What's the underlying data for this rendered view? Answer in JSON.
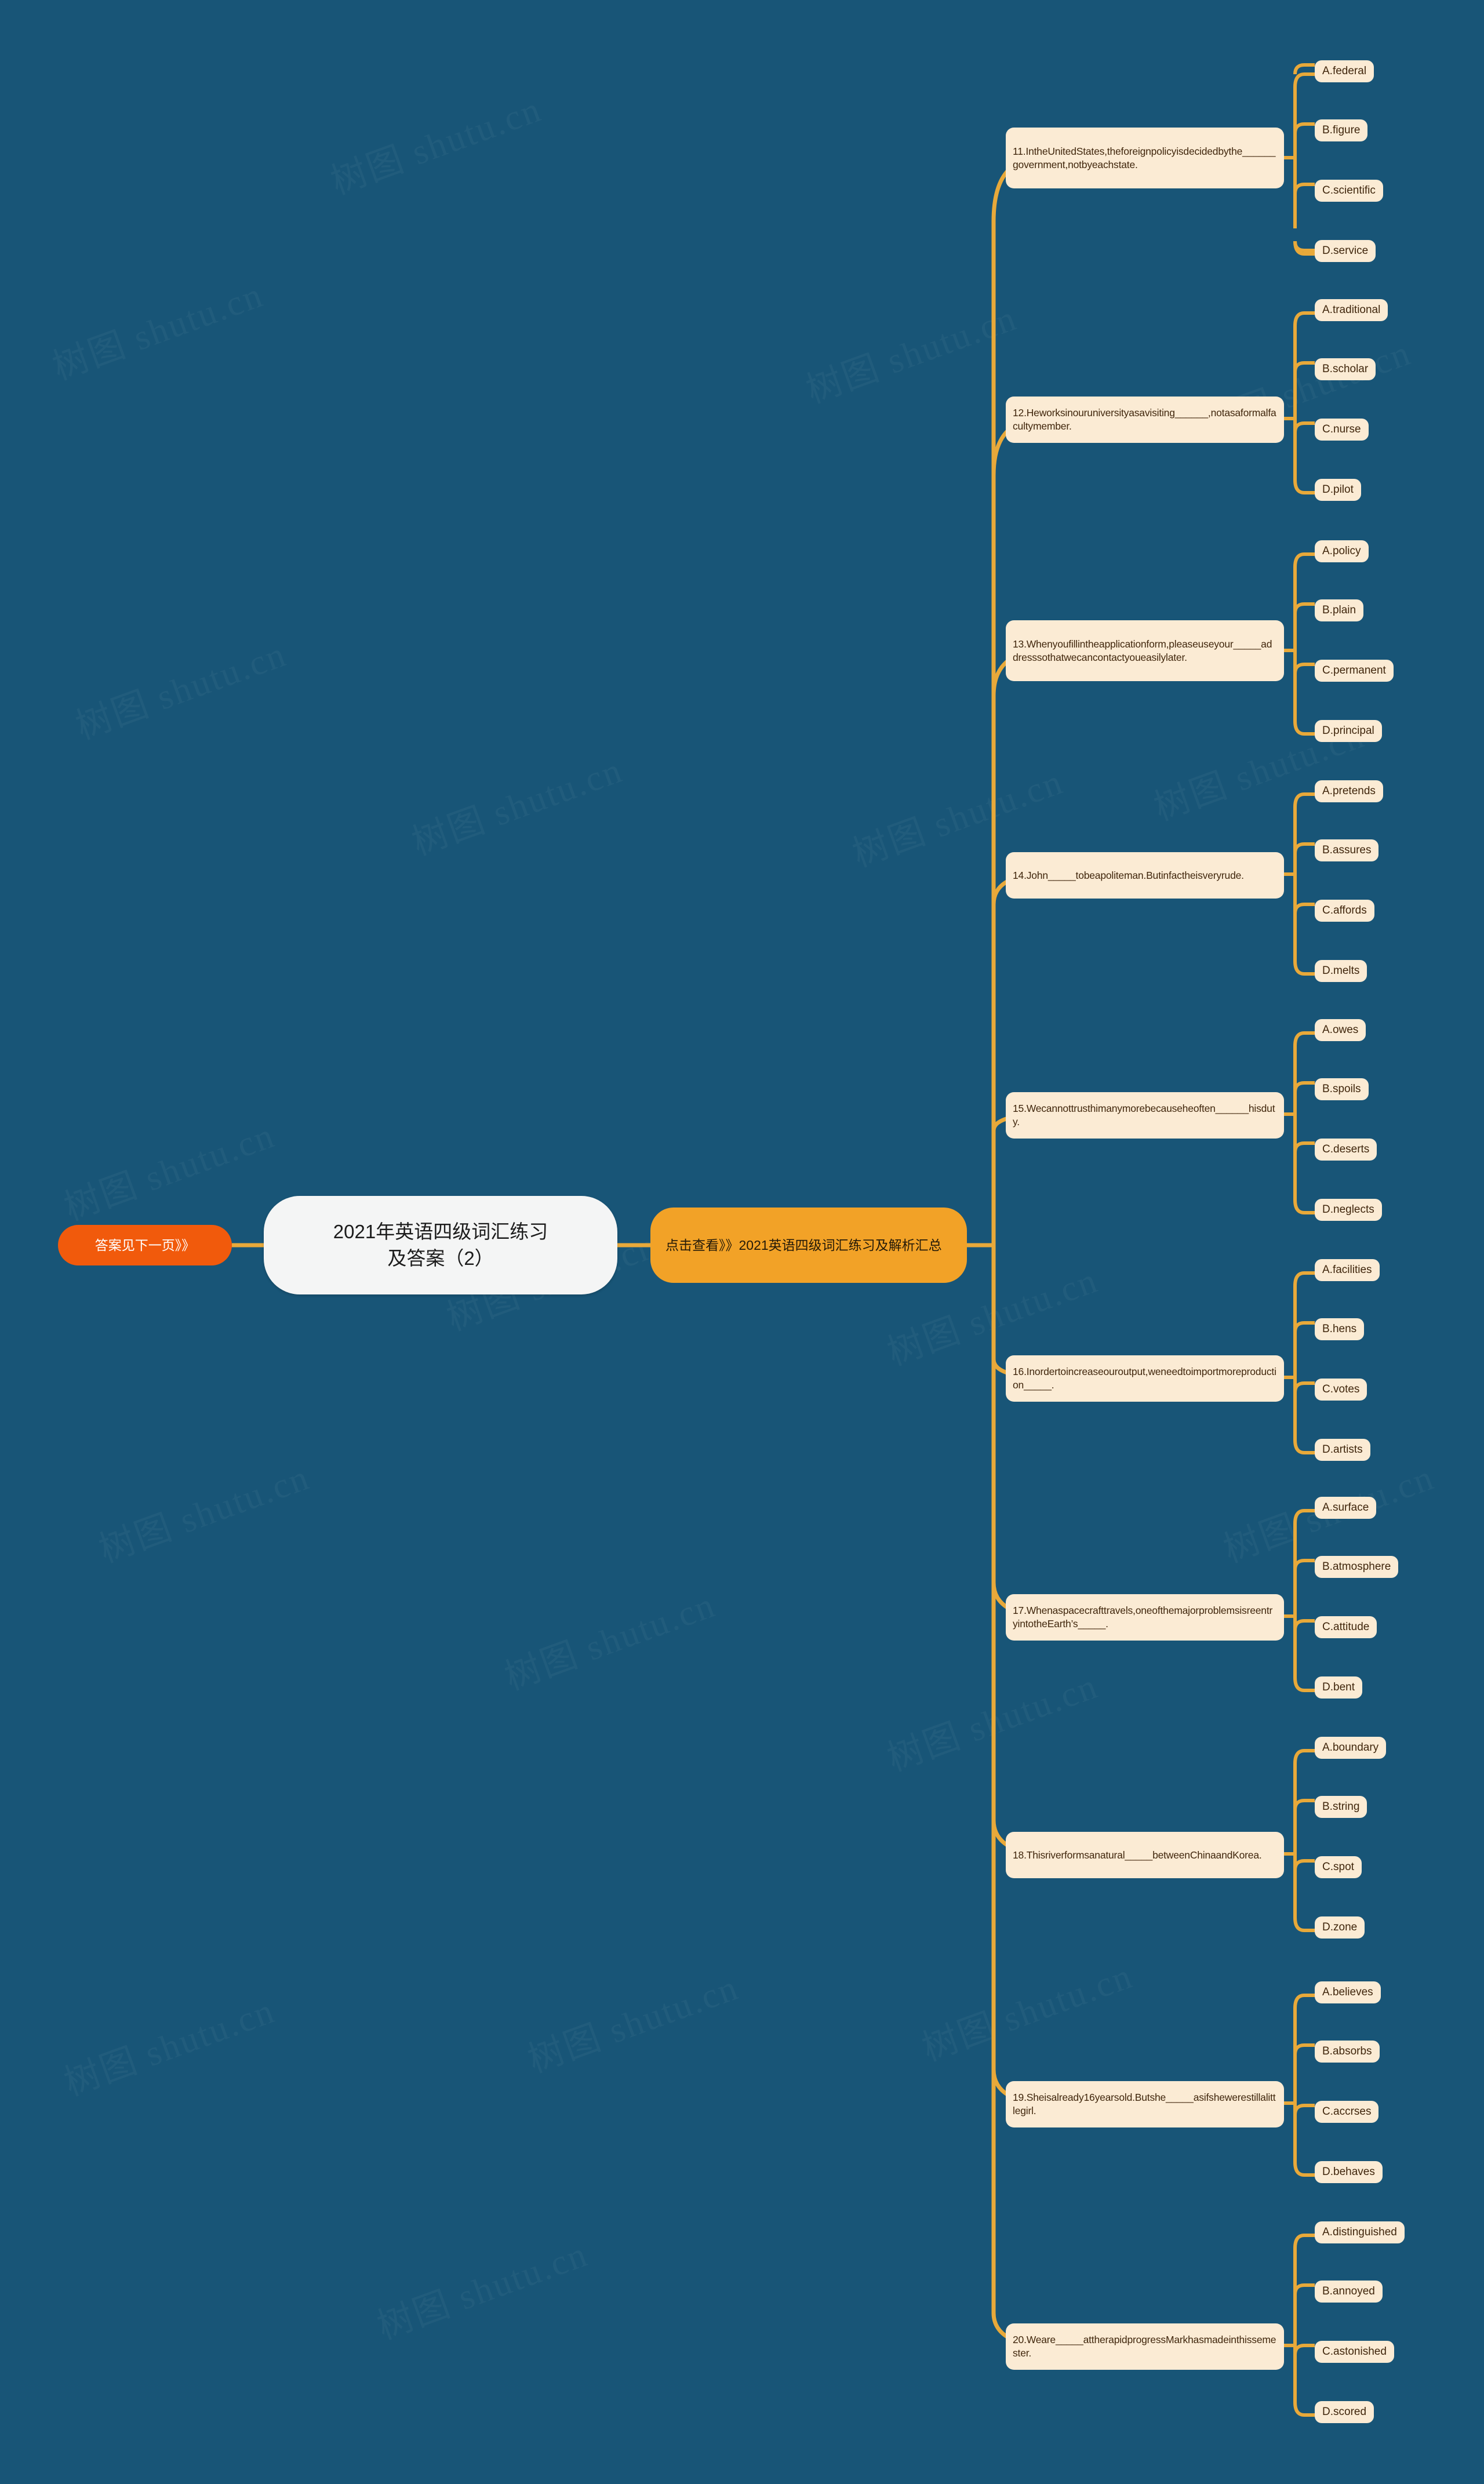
{
  "canvas": {
    "background_color": "#185577",
    "connector_color": "#E8A93A",
    "watermark_text": "树图 shutu.cn"
  },
  "root": {
    "label": "2021年英语四级词汇练习及答案（2）",
    "line1": "2021年英语四级词汇练习",
    "line2": "及答案（2）",
    "background_color": "#F4F5F5",
    "text_color": "#1C1C1C"
  },
  "left_branch": {
    "label": "答案见下一页》》",
    "background_color": "#F15A0C",
    "text_color": "#FFFFFF"
  },
  "right_branch": {
    "label": "点击查看》》2021英语四级词汇练习及解析汇总",
    "background_color": "#F2A227",
    "text_color": "#241A08"
  },
  "questions": [
    {
      "id": "q11",
      "text": "11.IntheUnitedStates,theforeignpolicyisdecidedbythe______government,notbyeachstate.",
      "options": [
        "A.federal",
        "B.figure",
        "C.scientific",
        "D.service"
      ]
    },
    {
      "id": "q12",
      "text": "12.Heworksinouruniversityasavisiting______,notasaformalfacultymember.",
      "options": [
        "A.traditional",
        "B.scholar",
        "C.nurse",
        "D.pilot"
      ]
    },
    {
      "id": "q13",
      "text": "13.Whenyoufillintheapplicationform,pleaseuseyour_____addresssothatwecancontactyoueasilylater.",
      "options": [
        "A.policy",
        "B.plain",
        "C.permanent",
        "D.principal"
      ]
    },
    {
      "id": "q14",
      "text": "14.John_____tobeapoliteman.Butinfactheisveryrude.",
      "options": [
        "A.pretends",
        "B.assures",
        "C.affords",
        "D.melts"
      ]
    },
    {
      "id": "q15",
      "text": "15.Wecannottrusthimanymorebecauseheoften______hisduty.",
      "options": [
        "A.owes",
        "B.spoils",
        "C.deserts",
        "D.neglects"
      ]
    },
    {
      "id": "q16",
      "text": "16.Inordertoincreaseouroutput,weneedtoimportmoreproduction_____.",
      "options": [
        "A.facilities",
        "B.hens",
        "C.votes",
        "D.artists"
      ]
    },
    {
      "id": "q17",
      "text": "17.Whenaspacecrafttravels,oneofthemajorproblemsisreentryintotheEarth’s_____.",
      "options": [
        "A.surface",
        "B.atmosphere",
        "C.attitude",
        "D.bent"
      ]
    },
    {
      "id": "q18",
      "text": "18.Thisriverformsanatural_____betweenChinaandKorea.",
      "options": [
        "A.boundary",
        "B.string",
        "C.spot",
        "D.zone"
      ]
    },
    {
      "id": "q19",
      "text": "19.Sheisalready16yearsold.Butshe_____asifshewerestillalittlegirl.",
      "options": [
        "A.believes",
        "B.absorbs",
        "C.accrses",
        "D.behaves"
      ]
    },
    {
      "id": "q20",
      "text": "20.Weare_____attherapidprogressMarkhasmadeinthissemester.",
      "options": [
        "A.distinguished",
        "B.annoyed",
        "C.astonished",
        "D.scored"
      ]
    }
  ]
}
